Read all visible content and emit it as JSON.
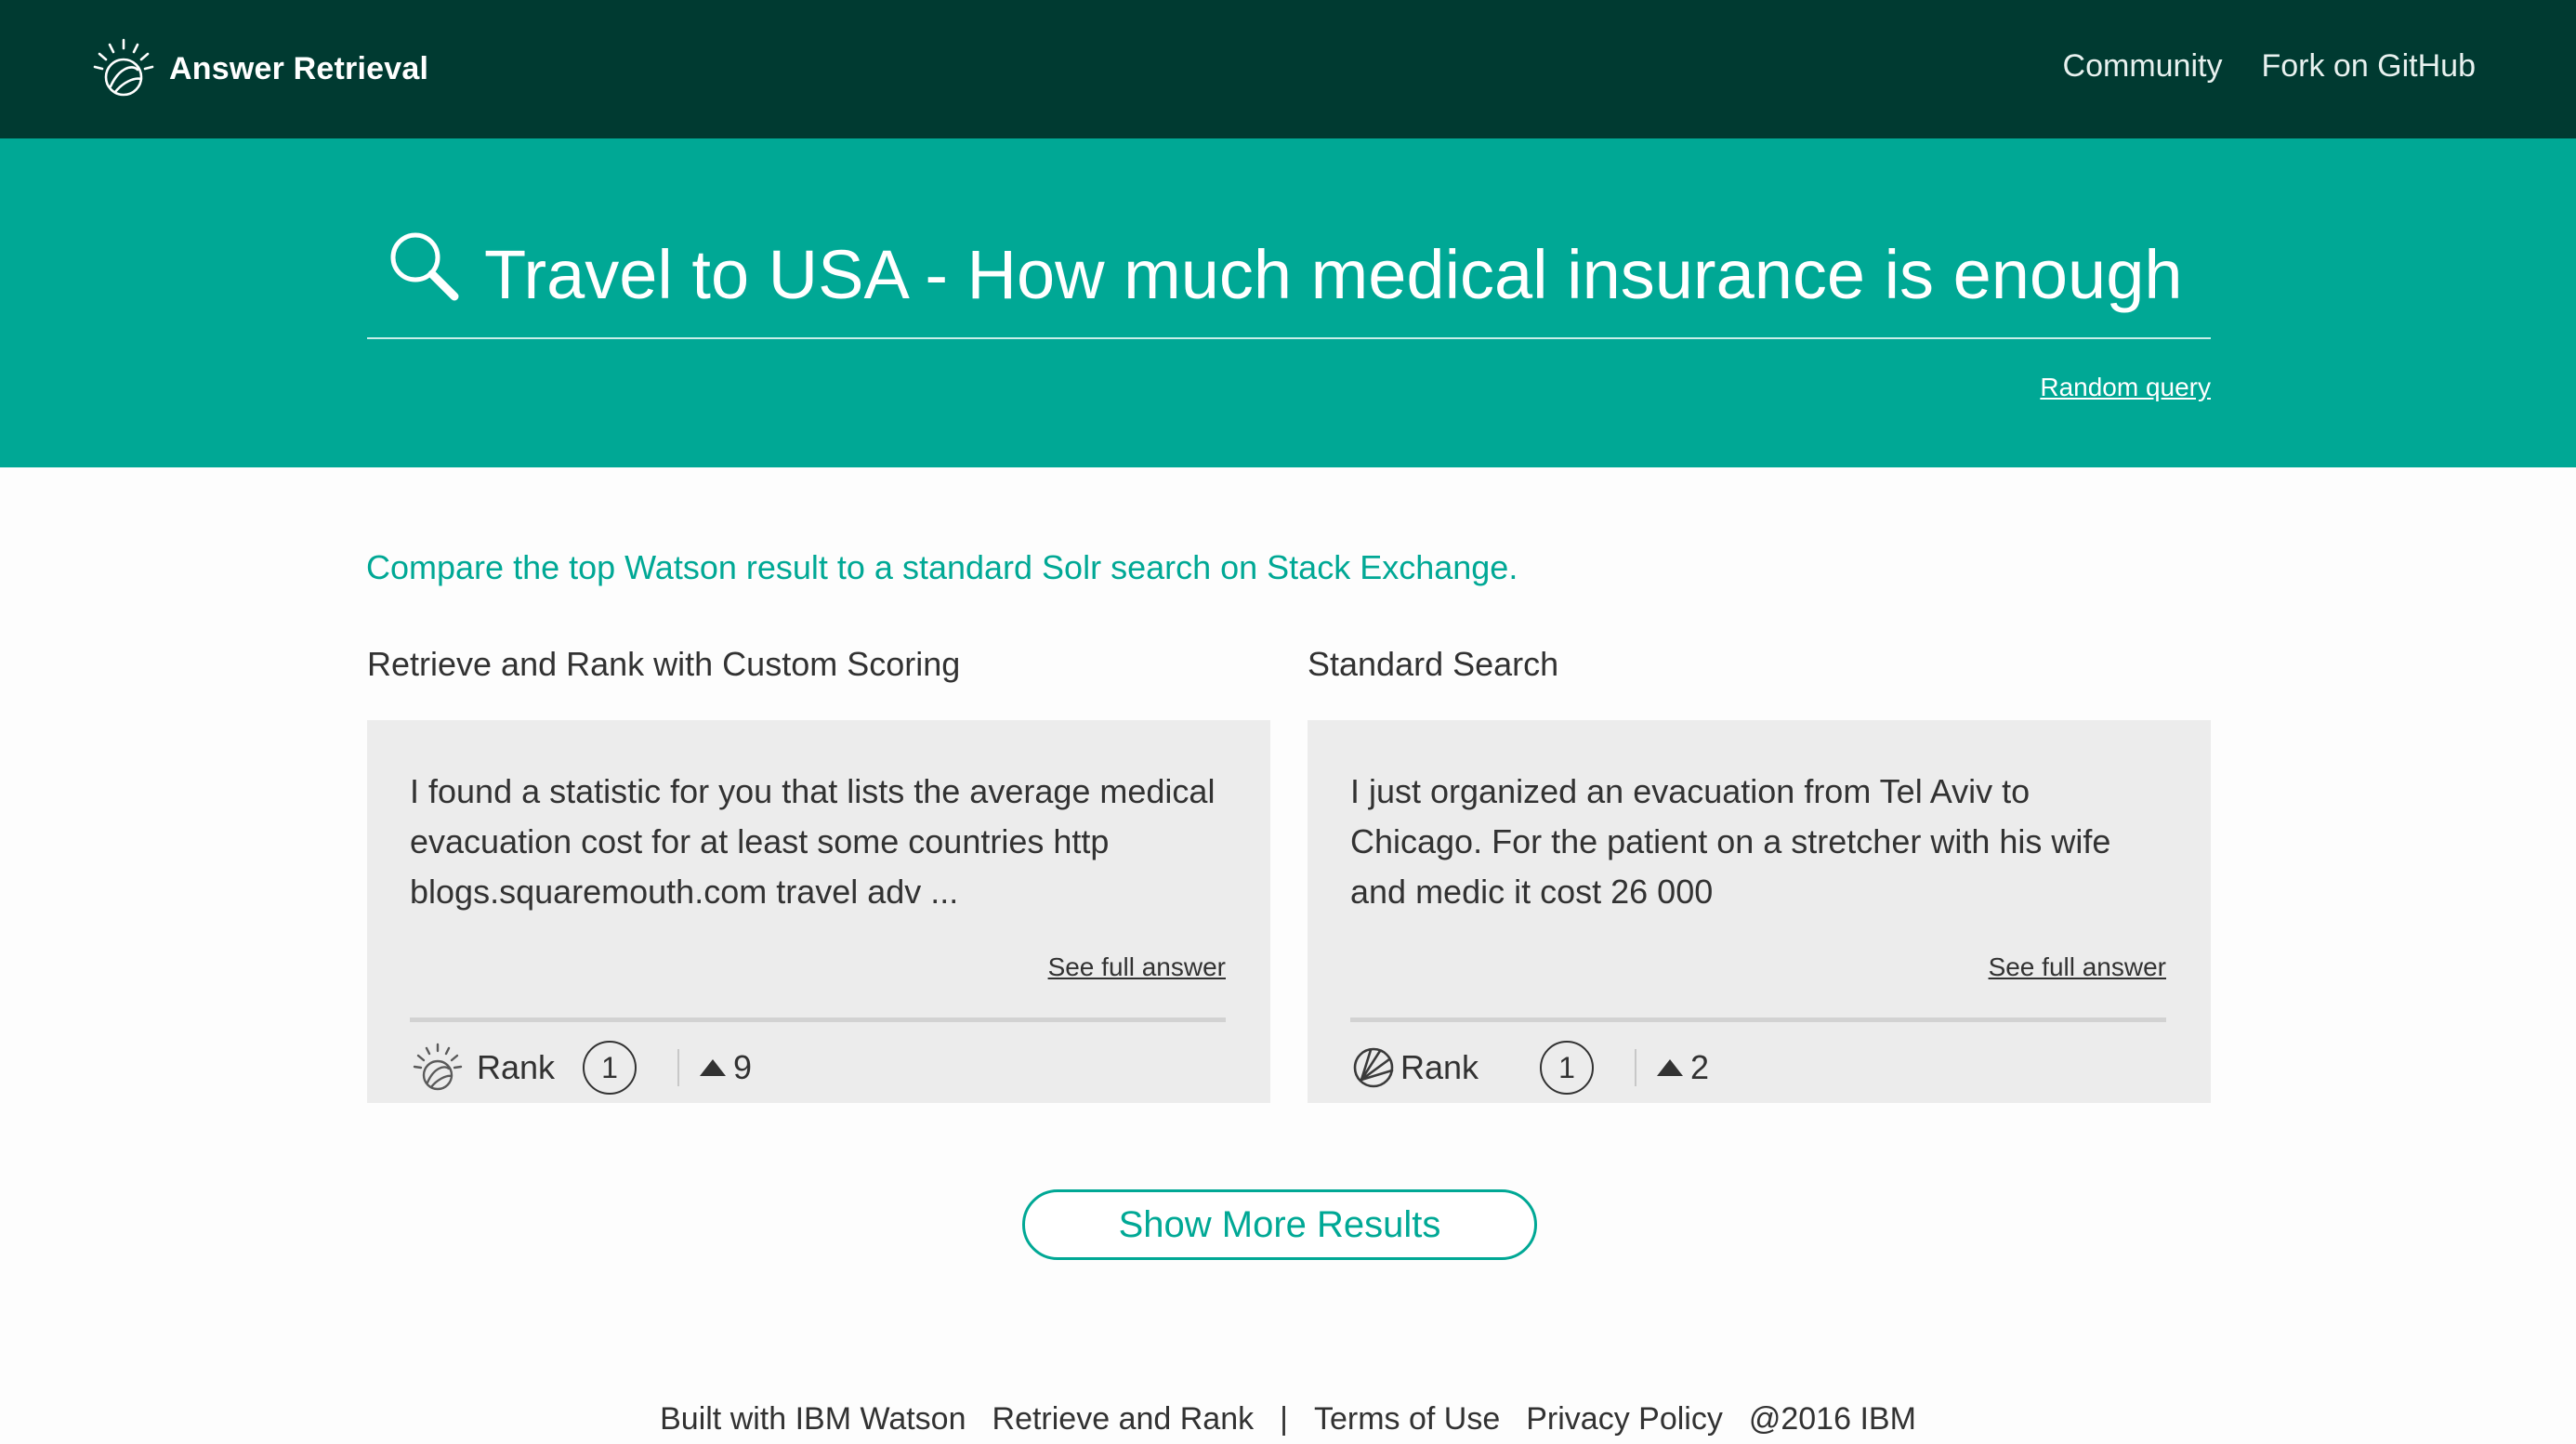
{
  "header": {
    "brand_title": "Answer Retrieval",
    "brand_icon": "watson-logo-icon",
    "nav": [
      "Community",
      "Fork on GitHub"
    ]
  },
  "search": {
    "icon": "search-icon",
    "query": "Travel to USA - How much medical insurance is enough",
    "random_label": "Random query"
  },
  "main": {
    "intro": "Compare the top Watson result to a standard Solr search on Stack Exchange.",
    "columns": [
      {
        "title": "Retrieve and Rank with Custom Scoring",
        "answer": "I found a statistic for you that lists the average medical evacuation cost for at least some countries http blogs.squaremouth.com travel adv ...",
        "link_label": "See full answer",
        "icon": "watson-icon",
        "rank_label": "Rank",
        "rank": "1",
        "votes": "9"
      },
      {
        "title": "Standard Search",
        "answer": "I just organized an evacuation from Tel Aviv to Chicago. For the patient on a stretcher with his wife and medic it cost 26 000",
        "link_label": "See full answer",
        "icon": "solr-icon",
        "rank_label": "Rank",
        "rank": "1",
        "votes": "2"
      }
    ],
    "show_more_label": "Show More Results"
  },
  "footer": {
    "built_with": "Built with IBM Watson",
    "retrieve_rank": "Retrieve and Rank",
    "separator": "|",
    "terms": "Terms of Use",
    "privacy": "Privacy Policy",
    "copyright": "@2016 IBM"
  },
  "colors": {
    "header_bg": "#003a31",
    "accent": "#00a895",
    "card_bg": "#ececec"
  }
}
